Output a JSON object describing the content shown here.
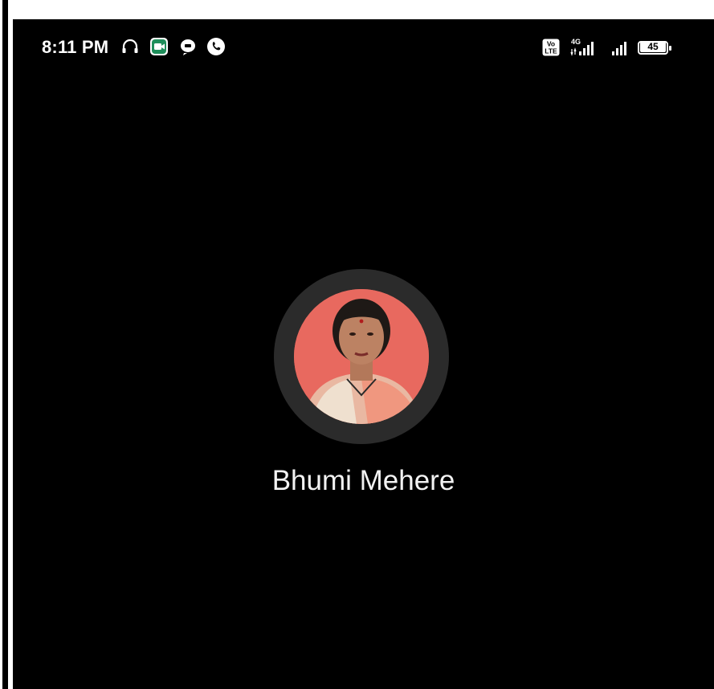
{
  "status_bar": {
    "time": "8:11 PM",
    "left_icons": [
      "headphones-icon",
      "google-meet-icon",
      "chat-bubble-icon",
      "phone-call-icon"
    ],
    "right_icons": [
      "volte-icon",
      "signal-4g-icon",
      "signal-icon",
      "battery-icon"
    ],
    "volte_label": "Vo\nLTE",
    "network_label": "4G",
    "battery_level": "45"
  },
  "call": {
    "caller_name": "Bhumi Mehere"
  },
  "colors": {
    "background": "#000000",
    "avatar_ring": "#2b2b2b",
    "avatar_bg": "#e8695f",
    "text": "#f2f2f2"
  }
}
